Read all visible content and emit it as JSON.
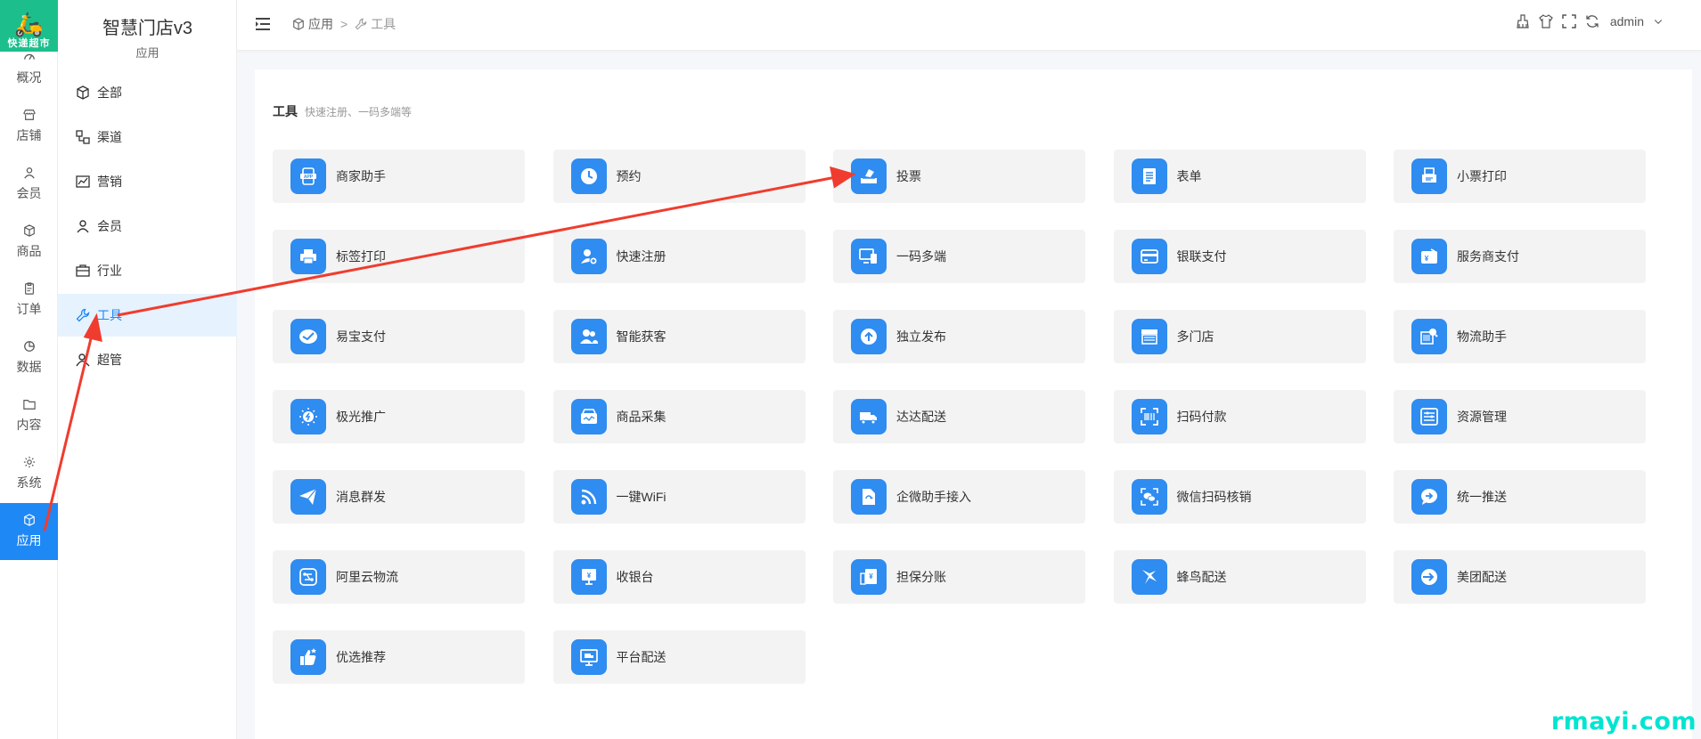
{
  "logo": {
    "text": "快递超市"
  },
  "rail": {
    "items": [
      {
        "label": "概况",
        "icon": "dashboard-icon"
      },
      {
        "label": "店铺",
        "icon": "store-icon"
      },
      {
        "label": "会员",
        "icon": "user-icon"
      },
      {
        "label": "商品",
        "icon": "box-icon"
      },
      {
        "label": "订单",
        "icon": "clipboard-icon"
      },
      {
        "label": "数据",
        "icon": "pie-chart-icon"
      },
      {
        "label": "内容",
        "icon": "folder-icon"
      },
      {
        "label": "系统",
        "icon": "gear-icon"
      },
      {
        "label": "应用",
        "icon": "box-icon",
        "active": true
      }
    ]
  },
  "sidebar": {
    "title": "智慧门店v3",
    "subtitle": "应用",
    "items": [
      {
        "label": "全部",
        "icon": "box-icon"
      },
      {
        "label": "渠道",
        "icon": "channel-icon"
      },
      {
        "label": "营销",
        "icon": "trend-icon"
      },
      {
        "label": "会员",
        "icon": "user-icon"
      },
      {
        "label": "行业",
        "icon": "briefcase-icon"
      },
      {
        "label": "工具",
        "icon": "wrench-icon",
        "active": true
      },
      {
        "label": "超管",
        "icon": "admin-icon"
      }
    ]
  },
  "header": {
    "breadcrumb": {
      "first": "应用",
      "separator": ">",
      "second": "工具"
    },
    "user": "admin"
  },
  "section": {
    "title": "工具",
    "description": "快速注册、一码多端等"
  },
  "tiles": [
    [
      "商家助手",
      "预约",
      "投票",
      "表单",
      "小票打印"
    ],
    [
      "标签打印",
      "快速注册",
      "一码多端",
      "银联支付",
      "服务商支付"
    ],
    [
      "易宝支付",
      "智能获客",
      "独立发布",
      "多门店",
      "物流助手"
    ],
    [
      "极光推广",
      "商品采集",
      "达达配送",
      "扫码付款",
      "资源管理"
    ],
    [
      "消息群发",
      "一键WiFi",
      "企微助手接入",
      "微信扫码核销",
      "统一推送"
    ],
    [
      "阿里云物流",
      "收银台",
      "担保分账",
      "蜂鸟配送",
      "美团配送"
    ],
    [
      "优选推荐",
      "平台配送"
    ]
  ],
  "colors": {
    "accent": "#1e88f5",
    "tile_icon": "#2f8cf0",
    "logo_bg": "#1cbf8b",
    "arrow": "#f03c2e"
  },
  "watermark": "rmayi.com"
}
